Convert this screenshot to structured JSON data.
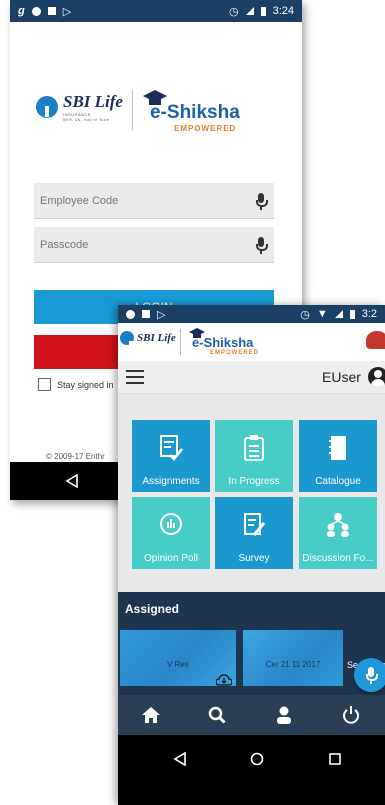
{
  "back_screen": {
    "status_bar": {
      "carrier_icon": "g",
      "time": "3:24"
    },
    "brand": {
      "sbi_name": "SBI Life",
      "sbi_sub": "INSURANCE",
      "sbi_tagline": "With Us, You're Sure",
      "eshiksha_name": "e-Shiksha",
      "eshiksha_sub": "EMPOWERED"
    },
    "employee_code": {
      "placeholder": "Employee Code",
      "value": ""
    },
    "passcode": {
      "placeholder": "Passcode",
      "value": ""
    },
    "login_label": "LOGIN",
    "stay_signed_label": "Stay signed in",
    "footer": "© 2009-17 Enthr"
  },
  "front_screen": {
    "status_bar": {
      "time": "3:2"
    },
    "brand": {
      "sbi_name": "SBI Life",
      "eshiksha_name": "e-Shiksha",
      "eshiksha_sub": "EMPOWERED"
    },
    "user_label": "EUser",
    "tiles": [
      {
        "label": "Assignments",
        "icon": "assignment-check-icon"
      },
      {
        "label": "In Progress",
        "icon": "clipboard-list-icon"
      },
      {
        "label": "Catalogue",
        "icon": "notebook-icon"
      },
      {
        "label": "Opinion Poll",
        "icon": "chat-poll-icon"
      },
      {
        "label": "Survey",
        "icon": "survey-edit-icon"
      },
      {
        "label": "Discussion Fo...",
        "icon": "group-people-icon"
      }
    ],
    "assigned": {
      "heading": "Assigned",
      "cards": [
        {
          "title": "V Res"
        },
        {
          "title": "Cer 21 11 2017"
        }
      ],
      "see_more": "See More"
    },
    "bottom_nav": [
      "home-icon",
      "search-icon",
      "person-icon",
      "power-icon"
    ],
    "colors": {
      "tile_dark": "#1b99cf",
      "tile_light": "#48ccc8",
      "assigned_bg": "#1e3550",
      "status_bar": "#1c3f66"
    }
  }
}
